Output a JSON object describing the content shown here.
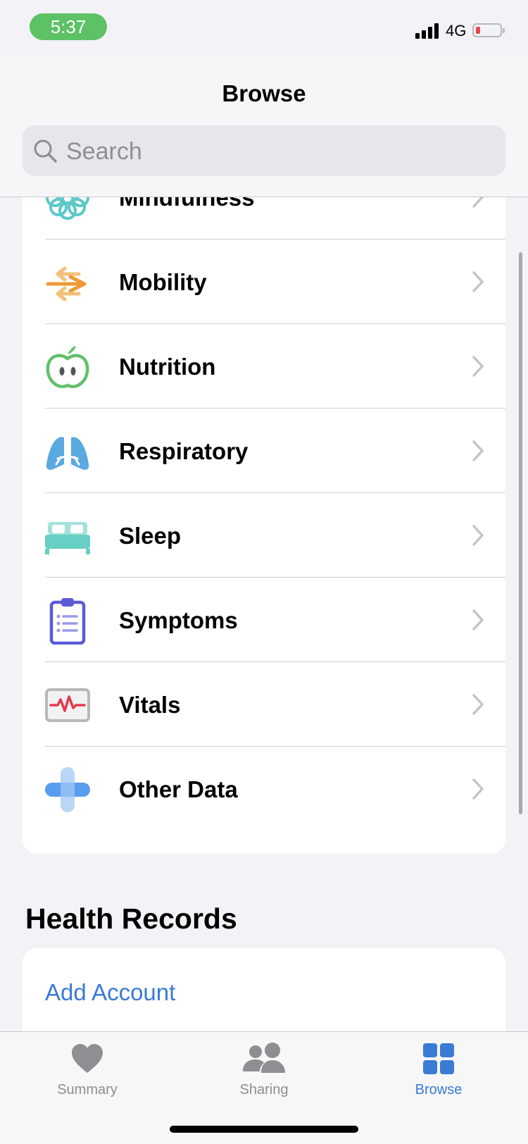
{
  "status_bar": {
    "time": "5:37",
    "network": "4G"
  },
  "header": {
    "title": "Browse",
    "search_placeholder": "Search"
  },
  "categories": [
    {
      "label": "Mindfulness",
      "icon": "mindfulness-icon",
      "color": "#5ac8c8"
    },
    {
      "label": "Mobility",
      "icon": "mobility-icon",
      "color": "#f0a342"
    },
    {
      "label": "Nutrition",
      "icon": "nutrition-icon",
      "color": "#62c06a"
    },
    {
      "label": "Respiratory",
      "icon": "respiratory-icon",
      "color": "#5aa9e0"
    },
    {
      "label": "Sleep",
      "icon": "sleep-icon",
      "color": "#67cfc4"
    },
    {
      "label": "Symptoms",
      "icon": "symptoms-icon",
      "color": "#5b5bd6"
    },
    {
      "label": "Vitals",
      "icon": "vitals-icon",
      "color": "#e5384e"
    },
    {
      "label": "Other Data",
      "icon": "other-data-icon",
      "color": "#5a9cf0"
    }
  ],
  "health_records": {
    "title": "Health Records",
    "add_account": "Add Account"
  },
  "tabs": [
    {
      "label": "Summary",
      "icon": "heart-icon",
      "active": false
    },
    {
      "label": "Sharing",
      "icon": "people-icon",
      "active": false
    },
    {
      "label": "Browse",
      "icon": "grid-icon",
      "active": true
    }
  ],
  "colors": {
    "accent": "#3a7bd5",
    "status_pill": "#5cc265",
    "inactive_tab": "#8e8e93"
  }
}
